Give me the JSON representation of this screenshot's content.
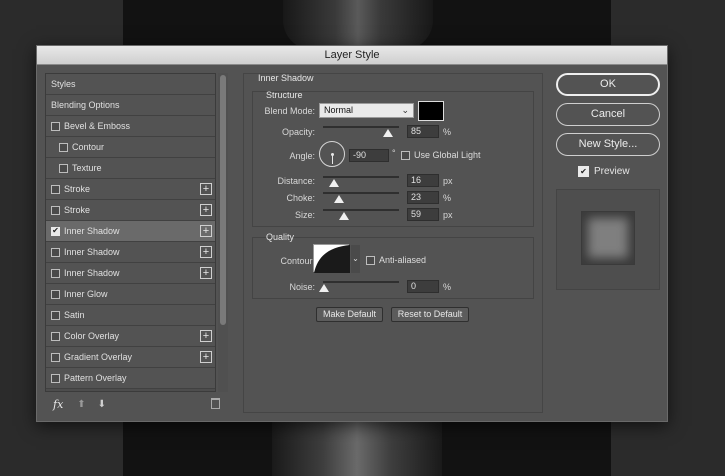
{
  "dialog": {
    "title": "Layer Style"
  },
  "styles_list": [
    {
      "label": "Styles",
      "checkbox": false,
      "checked": false,
      "plus": false,
      "indent": false,
      "selected": false
    },
    {
      "label": "Blending Options",
      "checkbox": false,
      "checked": false,
      "plus": false,
      "indent": false,
      "selected": false
    },
    {
      "label": "Bevel & Emboss",
      "checkbox": true,
      "checked": false,
      "plus": false,
      "indent": false,
      "selected": false
    },
    {
      "label": "Contour",
      "checkbox": true,
      "checked": false,
      "plus": false,
      "indent": true,
      "selected": false
    },
    {
      "label": "Texture",
      "checkbox": true,
      "checked": false,
      "plus": false,
      "indent": true,
      "selected": false
    },
    {
      "label": "Stroke",
      "checkbox": true,
      "checked": false,
      "plus": true,
      "indent": false,
      "selected": false
    },
    {
      "label": "Stroke",
      "checkbox": true,
      "checked": false,
      "plus": true,
      "indent": false,
      "selected": false
    },
    {
      "label": "Inner Shadow",
      "checkbox": true,
      "checked": true,
      "plus": true,
      "indent": false,
      "selected": true
    },
    {
      "label": "Inner Shadow",
      "checkbox": true,
      "checked": false,
      "plus": true,
      "indent": false,
      "selected": false
    },
    {
      "label": "Inner Shadow",
      "checkbox": true,
      "checked": false,
      "plus": true,
      "indent": false,
      "selected": false
    },
    {
      "label": "Inner Glow",
      "checkbox": true,
      "checked": false,
      "plus": false,
      "indent": false,
      "selected": false
    },
    {
      "label": "Satin",
      "checkbox": true,
      "checked": false,
      "plus": false,
      "indent": false,
      "selected": false
    },
    {
      "label": "Color Overlay",
      "checkbox": true,
      "checked": false,
      "plus": true,
      "indent": false,
      "selected": false
    },
    {
      "label": "Gradient Overlay",
      "checkbox": true,
      "checked": false,
      "plus": true,
      "indent": false,
      "selected": false
    },
    {
      "label": "Pattern Overlay",
      "checkbox": true,
      "checked": false,
      "plus": false,
      "indent": false,
      "selected": false
    }
  ],
  "footer": {
    "fx": "fx",
    "up_icon": "arrow-up-icon",
    "down_icon": "arrow-down-icon",
    "trash_icon": "trash-icon"
  },
  "panel": {
    "title": "Inner Shadow",
    "structure": {
      "title": "Structure",
      "blend_mode_label": "Blend Mode:",
      "blend_mode_value": "Normal",
      "shadow_color": "#000000",
      "opacity_label": "Opacity:",
      "opacity_value": "85",
      "opacity_unit": "%",
      "opacity_fraction": 0.85,
      "angle_label": "Angle:",
      "angle_value": "-90",
      "angle_unit": "°",
      "global_light_label": "Use Global Light",
      "global_light_checked": false,
      "distance_label": "Distance:",
      "distance_value": "16",
      "distance_unit": "px",
      "choke_label": "Choke:",
      "choke_value": "23",
      "choke_unit": "%",
      "size_label": "Size:",
      "size_value": "59",
      "size_unit": "px"
    },
    "quality": {
      "title": "Quality",
      "contour_label": "Contour:",
      "anti_aliased_label": "Anti-aliased",
      "anti_aliased_checked": false,
      "noise_label": "Noise:",
      "noise_value": "0",
      "noise_unit": "%"
    },
    "make_default": "Make Default",
    "reset_default": "Reset to Default"
  },
  "buttons": {
    "ok": "OK",
    "cancel": "Cancel",
    "new_style": "New Style..."
  },
  "preview": {
    "label": "Preview",
    "checked": true
  }
}
